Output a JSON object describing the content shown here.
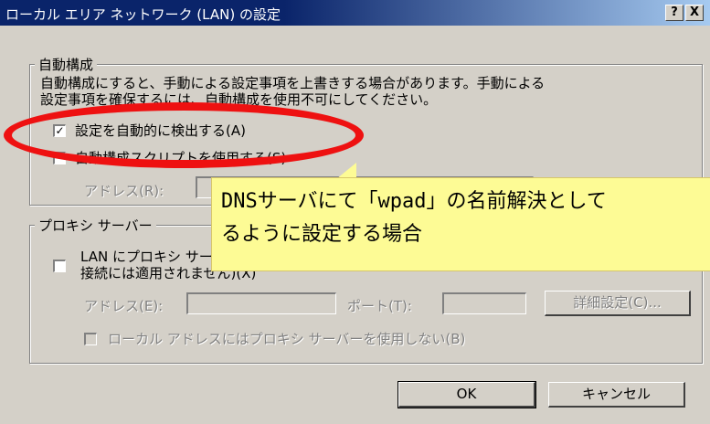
{
  "window": {
    "title": "ローカル エリア ネットワーク (LAN) の設定",
    "help_label": "?",
    "close_label": "X"
  },
  "auto_config": {
    "legend": "自動構成",
    "desc_line1": "自動構成にすると、手動による設定事項を上書きする場合があります。手動による",
    "desc_line2": "設定事項を確保するには、自動構成を使用不可にしてください。",
    "auto_detect_label": "設定を自動的に検出する(A)",
    "auto_detect_checked": true,
    "script_label": "自動構成スクリプトを使用する(S)",
    "script_checked": false,
    "address_label": "アドレス(R):"
  },
  "proxy": {
    "legend": "プロキシ サーバー",
    "use_proxy_line1": "LAN にプロキシ サーバーを使用する (これらの設定はダイヤルアップまたは VPN",
    "use_proxy_line2": "接続には適用されません)(X)",
    "use_proxy_checked": false,
    "address_label": "アドレス(E):",
    "port_label": "ポート(T):",
    "advanced_label": "詳細設定(C)...",
    "bypass_label": "ローカル アドレスにはプロキシ サーバーを使用しない(B)"
  },
  "buttons": {
    "ok": "OK",
    "cancel": "キャンセル"
  },
  "callout": {
    "line1": "DNSサーバにて「wpad」の名前解決として",
    "line2": "るように設定する場合"
  },
  "colors": {
    "highlight": "#ee1111",
    "callout_bg": "#fdfb95",
    "title_bar": "#0a246a"
  }
}
